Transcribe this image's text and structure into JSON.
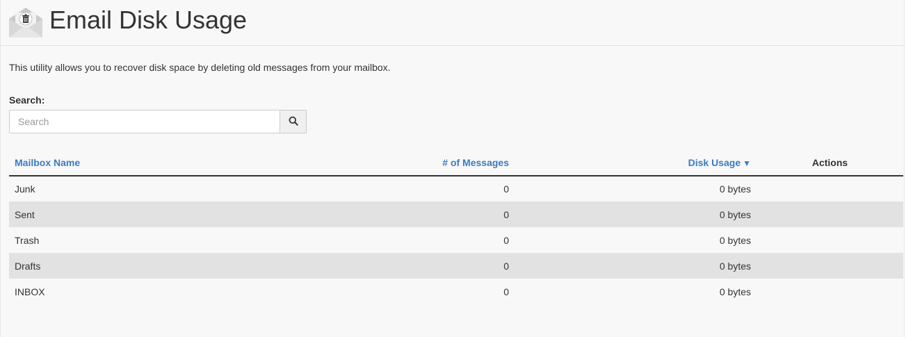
{
  "header": {
    "title": "Email Disk Usage",
    "icon": "email-trash-icon"
  },
  "description": "This utility allows you to recover disk space by deleting old messages from your mailbox.",
  "search": {
    "label": "Search:",
    "placeholder": "Search",
    "value": "",
    "button_icon": "search-icon"
  },
  "table": {
    "columns": {
      "mailbox_name": "Mailbox Name",
      "messages": "# of Messages",
      "disk_usage": "Disk Usage",
      "actions": "Actions"
    },
    "sort_indicator": "▼",
    "rows": [
      {
        "name": "Junk",
        "messages": "0",
        "disk_usage": "0 bytes"
      },
      {
        "name": "Sent",
        "messages": "0",
        "disk_usage": "0 bytes"
      },
      {
        "name": "Trash",
        "messages": "0",
        "disk_usage": "0 bytes"
      },
      {
        "name": "Drafts",
        "messages": "0",
        "disk_usage": "0 bytes"
      },
      {
        "name": "INBOX",
        "messages": "0",
        "disk_usage": "0 bytes"
      }
    ]
  },
  "colors": {
    "link": "#3b7bbf",
    "stripe": "#e2e2e2",
    "background": "#f8f8f8"
  }
}
